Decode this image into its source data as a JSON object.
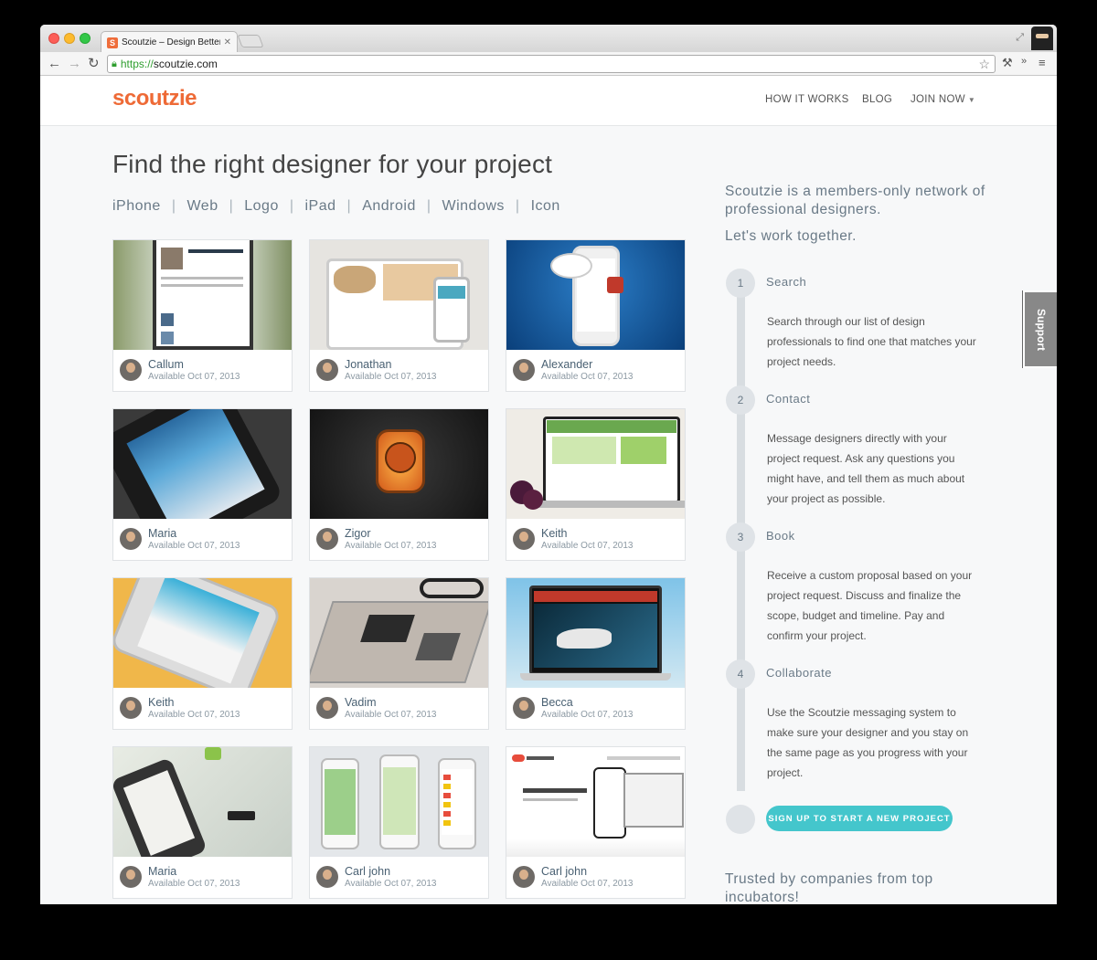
{
  "browser": {
    "tab_title": "Scoutzie – Design Better A",
    "tab_favicon": "S",
    "url_scheme": "https://",
    "url_host": "scoutzie.com"
  },
  "header": {
    "logo": "scoutzie",
    "nav": [
      {
        "label": "HOW IT WORKS"
      },
      {
        "label": "BLOG"
      },
      {
        "label": "JOIN NOW"
      }
    ]
  },
  "main": {
    "headline": "Find the right designer for your project",
    "categories": [
      "iPhone",
      "Web",
      "Logo",
      "iPad",
      "Android",
      "Windows",
      "Icon"
    ],
    "separator": "|",
    "cards": [
      {
        "name": "Callum",
        "available": "Available Oct 07, 2013"
      },
      {
        "name": "Jonathan",
        "available": "Available Oct 07, 2013"
      },
      {
        "name": "Alexander",
        "available": "Available Oct 07, 2013"
      },
      {
        "name": "Maria",
        "available": "Available Oct 07, 2013"
      },
      {
        "name": "Zigor",
        "available": "Available Oct 07, 2013"
      },
      {
        "name": "Keith",
        "available": "Available Oct 07, 2013"
      },
      {
        "name": "Keith",
        "available": "Available Oct 07, 2013"
      },
      {
        "name": "Vadim",
        "available": "Available Oct 07, 2013"
      },
      {
        "name": "Becca",
        "available": "Available Oct 07, 2013"
      },
      {
        "name": "Maria",
        "available": "Available Oct 07, 2013"
      },
      {
        "name": "Carl john",
        "available": "Available Oct 07, 2013"
      },
      {
        "name": "Carl john",
        "available": "Available Oct 07, 2013"
      }
    ]
  },
  "sidebar": {
    "intro": "Scoutzie is a members-only network of professional designers.",
    "intro2": "Let's work together.",
    "steps": [
      {
        "num": "1",
        "title": "Search",
        "text": "Search through our list of design professionals to find one that matches your project needs."
      },
      {
        "num": "2",
        "title": "Contact",
        "text": "Message designers directly with your project request. Ask any questions you might have, and tell them as much about your project as possible."
      },
      {
        "num": "3",
        "title": "Book",
        "text": "Receive a custom proposal based on your project request. Discuss and finalize the scope, budget and timeline. Pay and confirm your project."
      },
      {
        "num": "4",
        "title": "Collaborate",
        "text": "Use the Scoutzie messaging system to make sure your designer and you stay on the same page as you progress with your project."
      }
    ],
    "cta": "SIGN UP TO START A NEW PROJECT",
    "trusted": "Trusted by companies from top incubators!"
  },
  "support_tab": "Support",
  "colors": {
    "brand": "#ee6a36",
    "cta": "#44c6cc"
  }
}
